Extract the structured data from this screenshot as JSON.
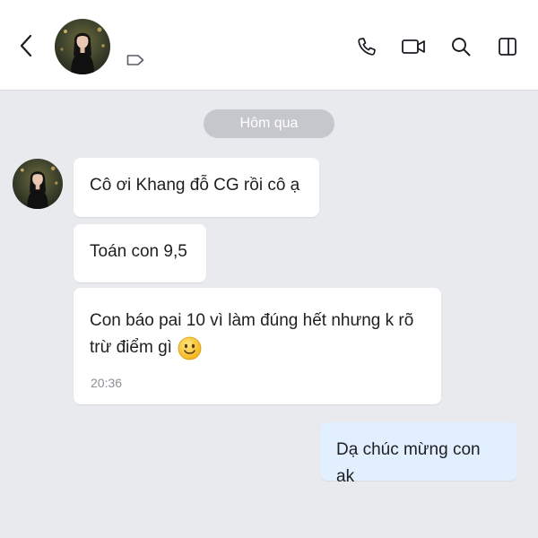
{
  "header": {
    "back_icon": "chevron-left-icon",
    "contact_avatar": "contact-photo",
    "label_icon": "tag-icon",
    "actions": [
      "phone-icon",
      "video-call-icon",
      "search-icon",
      "sidebar-toggle-icon"
    ]
  },
  "chat": {
    "date_divider": "Hôm qua",
    "incoming": [
      {
        "text": "Cô ơi Khang đỗ CG rồi cô ạ"
      },
      {
        "text": "Toán con 9,5"
      },
      {
        "line1": "Con báo pai 10 vì làm đúng hết nhưng k rõ",
        "line2": "trừ điểm gì",
        "emoji": "smiling-face-emoji",
        "time": "20:36"
      }
    ],
    "outgoing": [
      {
        "text": "Dạ chúc mừng con ak"
      }
    ]
  },
  "colors": {
    "background": "#e9eaee",
    "header": "#ffffff",
    "incoming_bubble": "#ffffff",
    "outgoing_bubble": "#e2efff",
    "date_pill": "#c6c7cc",
    "icon": "#1a1c22"
  }
}
